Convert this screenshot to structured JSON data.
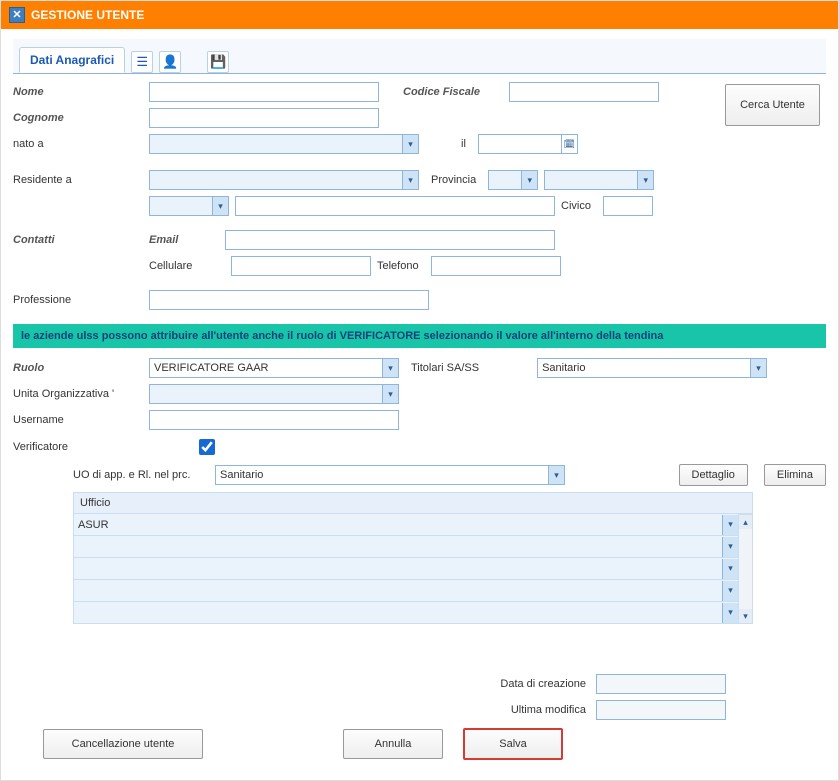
{
  "title": "GESTIONE UTENTE",
  "tab_label": "Dati Anagrafici",
  "labels": {
    "nome": "Nome",
    "cognome": "Cognome",
    "nato_a": "nato a",
    "il": "il",
    "codice_fiscale": "Codice Fiscale",
    "residente_a": "Residente a",
    "provincia": "Provincia",
    "civico": "Civico",
    "contatti": "Contatti",
    "email": "Email",
    "cellulare": "Cellulare",
    "telefono": "Telefono",
    "professione": "Professione",
    "ruolo": "Ruolo",
    "titolari": "Titolari SA/SS",
    "unita_org": "Unita Organizzativa '",
    "username": "Username",
    "verificatore": "Verificatore",
    "uo_app": "UO di app. e Rl. nel prc.",
    "ufficio": "Ufficio",
    "data_creazione": "Data di creazione",
    "ultima_modifica": "Ultima modifica"
  },
  "values": {
    "nome": "",
    "cognome": "",
    "codice_fiscale": "",
    "nato_a": "",
    "il": "",
    "residente_a": "",
    "provincia_sel": "",
    "provincia_txt": "",
    "civico": "",
    "addr_cap": "",
    "addr_via": "",
    "email": "",
    "cellulare": "",
    "telefono": "",
    "professione": "",
    "ruolo": "VERIFICATORE GAAR",
    "titolari": "Sanitario",
    "unita_org": "",
    "username": "",
    "verificatore_checked": true,
    "uo_app": "Sanitario",
    "grid_row0": "ASUR",
    "data_creazione": "",
    "ultima_modifica": ""
  },
  "banner": "le aziende ulss possono attribuire all'utente anche il ruolo di VERIFICATORE selezionando il valore all'interno della tendina",
  "buttons": {
    "cerca_utente": "Cerca Utente",
    "dettaglio": "Dettaglio",
    "elimina": "Elimina",
    "cancellazione": "Cancellazione utente",
    "annulla": "Annulla",
    "salva": "Salva"
  }
}
